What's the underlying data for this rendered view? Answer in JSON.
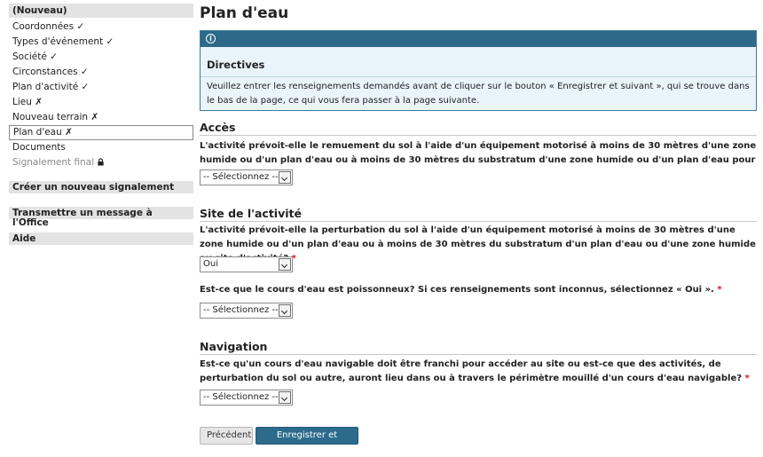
{
  "sidebar": {
    "header": "(Nouveau)",
    "items": [
      {
        "label": "Coordonnées ✓"
      },
      {
        "label": "Types d'événement ✓"
      },
      {
        "label": "Société ✓"
      },
      {
        "label": "Circonstances ✓"
      },
      {
        "label": "Plan d'activité ✓"
      },
      {
        "label": "Lieu ✗"
      },
      {
        "label": "Nouveau terrain ✗"
      },
      {
        "label": "Plan d'eau ✗"
      },
      {
        "label": "Documents"
      },
      {
        "label": "Signalement final"
      }
    ],
    "sections": [
      "Créer un nouveau signalement",
      "Transmettre un message à l'Office",
      "Aide"
    ]
  },
  "main": {
    "title": "Plan d'eau",
    "info": {
      "icon": "info-icon",
      "title": "Directives",
      "text": "Veuillez entrer les renseignements demandés avant de cliquer sur le bouton « Enregistrer et suivant », qui se trouve dans le bas de la page, ce qui vous fera passer à la page suivante."
    },
    "sections": {
      "acces": {
        "title": "Accès",
        "question": "L'activité prévoit-elle le remuement du sol à l'aide d'un équipement motorisé à moins de 30 mètres d'une zone humide ou d'un plan d'eau ou à moins de 30 mètres du substratum d'une zone humide ou d'un plan d'eau pour accéder au site?",
        "select_value": "-- Sélectionnez --"
      },
      "site": {
        "title": "Site de l'activité",
        "question1": "L'activité prévoit-elle la perturbation du sol à l'aide d'un équipement motorisé à moins de 30 mètres d'une zone humide ou d'un plan d'eau ou à moins de 30 mètres du substratum d'un plan d'eau ou d'une zone humide au site d'activité?",
        "select1_value": "Oui",
        "question2": "Est-ce que le cours d'eau est poissonneux? Si ces renseignements sont inconnus, sélectionnez « Oui ».",
        "select2_value": "-- Sélectionnez --"
      },
      "navigation": {
        "title": "Navigation",
        "question": "Est-ce qu'un cours d'eau navigable doit être franchi pour accéder au site ou est-ce que des activités, de perturbation du sol ou autre, auront lieu dans ou à travers le périmètre mouillé d'un cours d'eau navigable?",
        "select_value": "-- Sélectionnez --"
      }
    },
    "required_mark": "*",
    "buttons": {
      "prev": "Précédent",
      "next": "Enregistrer et suivant"
    }
  }
}
